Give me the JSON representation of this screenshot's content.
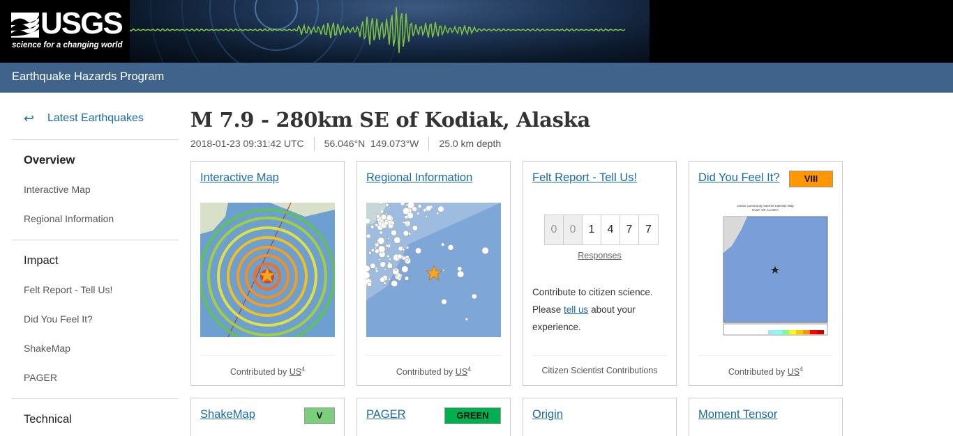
{
  "header": {
    "logo_text": "USGS",
    "logo_tagline": "science for a changing world",
    "program": "Earthquake Hazards Program"
  },
  "sidebar": {
    "back_arrow": "↩",
    "back_label": "Latest Earthquakes",
    "sections": [
      {
        "heading": "Overview",
        "items": [
          "Interactive Map",
          "Regional Information"
        ]
      },
      {
        "heading": "Impact",
        "items": [
          "Felt Report - Tell Us!",
          "Did You Feel It?",
          "ShakeMap",
          "PAGER"
        ]
      },
      {
        "heading": "Technical",
        "items": []
      }
    ]
  },
  "event": {
    "title": "M 7.9 - 280km SE of Kodiak, Alaska",
    "time": "2018-01-23 09:31:42 UTC",
    "coords": "56.046°N  149.073°W",
    "depth": "25.0 km depth"
  },
  "cards": {
    "interactive_map": {
      "title": "Interactive Map",
      "footer_prefix": "Contributed by ",
      "network": "US",
      "sup": "4"
    },
    "regional": {
      "title": "Regional Information",
      "footer_prefix": "Contributed by ",
      "network": "US",
      "sup": "4"
    },
    "felt": {
      "title": "Felt Report - Tell Us!",
      "digits": [
        "0",
        "0",
        "1",
        "4",
        "7",
        "7"
      ],
      "responses_label": "Responses",
      "text_before": "Contribute to citizen science. Please ",
      "link_text": "tell us",
      "text_after": " about your experience.",
      "footer": "Citizen Scientist Contributions"
    },
    "dyfi": {
      "title": "Did You Feel It?",
      "badge": "VIII",
      "badge_color": "#ff9800",
      "footer_prefix": "Contributed by ",
      "network": "US",
      "sup": "4",
      "map_title": "USGS Community Internet Intensity Map",
      "map_subtitle": "GULF OF ALASKA"
    },
    "shakemap": {
      "title": "ShakeMap",
      "badge": "V",
      "badge_color": "#7ccd7c"
    },
    "pager": {
      "title": "PAGER",
      "badge": "GREEN",
      "badge_color": "#00b050"
    },
    "origin": {
      "title": "Origin"
    },
    "moment_tensor": {
      "title": "Moment Tensor"
    }
  },
  "colors": {
    "link": "#1a6aa6",
    "program_bar": "#3f638b"
  }
}
